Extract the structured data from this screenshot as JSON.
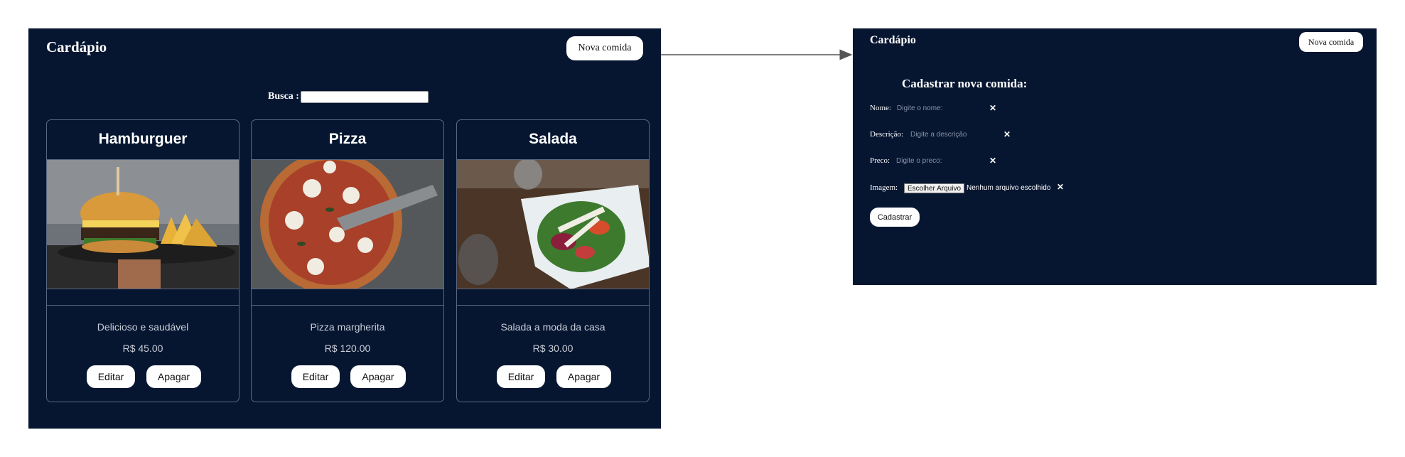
{
  "list_screen": {
    "title": "Cardápio",
    "new_button": "Nova comida",
    "search_label": "Busca :",
    "search_value": "",
    "cards": [
      {
        "name": "Hamburguer",
        "description": "Delicioso e saudável",
        "price": "R$ 45.00",
        "edit": "Editar",
        "delete": "Apagar",
        "image": "hamburger-photo"
      },
      {
        "name": "Pizza",
        "description": "Pizza margherita",
        "price": "R$ 120.00",
        "edit": "Editar",
        "delete": "Apagar",
        "image": "pizza-photo"
      },
      {
        "name": "Salada",
        "description": "Salada a moda da casa",
        "price": "R$ 30.00",
        "edit": "Editar",
        "delete": "Apagar",
        "image": "salad-photo"
      }
    ]
  },
  "form_screen": {
    "title": "Cardápio",
    "new_button": "Nova comida",
    "heading": "Cadastrar nova comida:",
    "fields": {
      "name": {
        "label": "Nome:",
        "placeholder": "Digite o nome:"
      },
      "description": {
        "label": "Descrição:",
        "placeholder": "Digite a descrição"
      },
      "price": {
        "label": "Preco:",
        "placeholder": "Digite o preco:"
      },
      "image": {
        "label": "Imagem:",
        "button": "Escolher Arquivo",
        "status": "Nenhum arquivo escolhido"
      }
    },
    "clear_icon": "✕",
    "submit": "Cadastrar"
  },
  "colors": {
    "background": "#061631",
    "arrow": "#555555"
  }
}
